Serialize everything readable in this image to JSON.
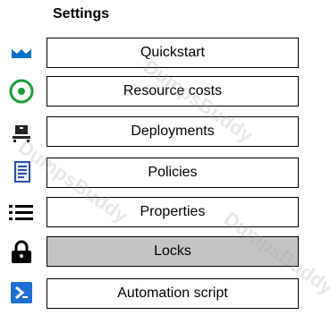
{
  "header": {
    "title": "Settings"
  },
  "menu": {
    "items": [
      {
        "label": "Quickstart",
        "icon": "quickstart-cloud-icon",
        "color": "#0072c6"
      },
      {
        "label": "Resource costs",
        "icon": "cost-circle-icon",
        "color": "#1a9e3a"
      },
      {
        "label": "Deployments",
        "icon": "deployments-icon",
        "color": "#222222"
      },
      {
        "label": "Policies",
        "icon": "policy-document-icon",
        "color": "#2a4fa8"
      },
      {
        "label": "Properties",
        "icon": "list-icon",
        "color": "#000000"
      },
      {
        "label": "Locks",
        "icon": "lock-icon",
        "color": "#000000",
        "selected": true
      },
      {
        "label": "Automation script",
        "icon": "script-powershell-icon",
        "color": "#1f6fd1"
      }
    ]
  },
  "watermark": {
    "text": "DumpsBuddy"
  }
}
